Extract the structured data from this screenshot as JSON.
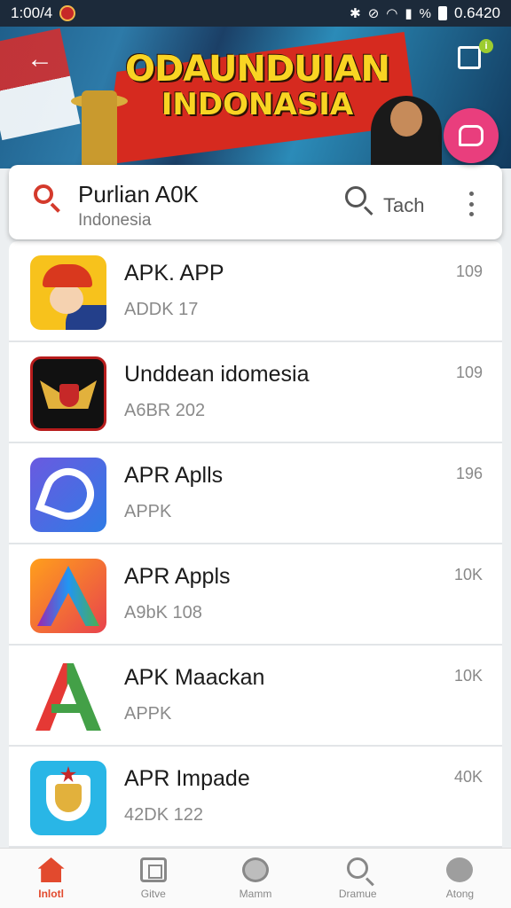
{
  "status_bar": {
    "time": "1:00/4",
    "right_text": "0.6420",
    "battery_percent": "%"
  },
  "banner": {
    "title_line1": "ODAUNDUIAN",
    "title_line2": "INDONASIA"
  },
  "search": {
    "title": "Purlian A0K",
    "subtitle": "Indonesia",
    "tab_label": "Tach"
  },
  "apps": [
    {
      "name": "APK. APP",
      "sub": "ADDK 17",
      "count": "109",
      "icon": "cartoon-man-icon"
    },
    {
      "name": "Unddean idomesia",
      "sub": "A6BR 202",
      "count": "109",
      "icon": "garuda-icon"
    },
    {
      "name": "APR Aplls",
      "sub": "APPK",
      "count": "196",
      "icon": "blue-logo-icon"
    },
    {
      "name": "APR Appls",
      "sub": "A9bK 108",
      "count": "10K",
      "icon": "rainbow-a-icon"
    },
    {
      "name": "APK Maackan",
      "sub": "APPK",
      "count": "10K",
      "icon": "green-red-a-icon"
    },
    {
      "name": "APR Impade",
      "sub": "42DK 122",
      "count": "40K",
      "icon": "emblem-icon"
    }
  ],
  "bottom_nav": [
    {
      "label": "Inlotl",
      "icon": "home-icon",
      "active": true
    },
    {
      "label": "Gitve",
      "icon": "games-icon",
      "active": false
    },
    {
      "label": "Mamm",
      "icon": "smile-icon",
      "active": false
    },
    {
      "label": "Dramue",
      "icon": "search-icon",
      "active": false
    },
    {
      "label": "Atong",
      "icon": "user-icon",
      "active": false
    }
  ],
  "colors": {
    "accent": "#e24a2e",
    "banner_red": "#d62a1f",
    "fab": "#e93e7d",
    "status_bar": "#1c2a3a"
  }
}
